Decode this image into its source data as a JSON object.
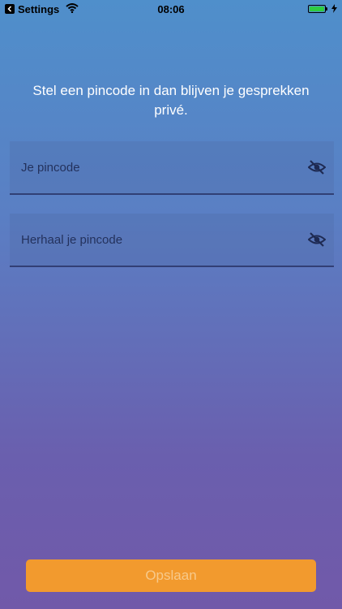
{
  "status_bar": {
    "back_app": "Settings",
    "time": "08:06"
  },
  "heading": "Stel een pincode in dan blijven je gesprekken privé.",
  "fields": {
    "pincode_placeholder": "Je pincode",
    "pincode_value": "",
    "repeat_placeholder": "Herhaal je pincode",
    "repeat_value": ""
  },
  "save_button": {
    "label": "Opslaan"
  },
  "icons": {
    "visibility_toggle": "eye-off-icon",
    "wifi": "wifi-icon",
    "battery": "battery-icon",
    "back": "back-arrow-icon"
  },
  "colors": {
    "button": "#f29a2e",
    "gradient_top": "#4f8fcb",
    "gradient_bottom": "#7159a9"
  }
}
